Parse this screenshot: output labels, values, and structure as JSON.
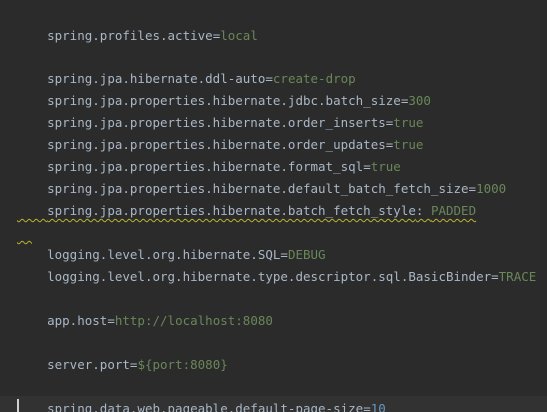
{
  "editor": {
    "lines": [
      {
        "key": "spring.profiles.active",
        "sep": "=",
        "value": "local"
      },
      {
        "key": "spring.jpa.hibernate.ddl-auto",
        "sep": "=",
        "value": "create-drop"
      },
      {
        "key": "spring.jpa.properties.hibernate.jdbc.batch_size",
        "sep": "=",
        "value": "300"
      },
      {
        "key": "spring.jpa.properties.hibernate.order_inserts",
        "sep": "=",
        "value": "true"
      },
      {
        "key": "spring.jpa.properties.hibernate.order_updates",
        "sep": "=",
        "value": "true"
      },
      {
        "key": "spring.jpa.properties.hibernate.format_sql",
        "sep": "=",
        "value": "true"
      },
      {
        "key": "spring.jpa.properties.hibernate.default_batch_fetch_size",
        "sep": "=",
        "value": "1000"
      },
      {
        "key": "spring.jpa.properties.hibernate.batch_fetch_style",
        "sep": ": ",
        "value": "PADDED"
      },
      {
        "key": "logging.level.org.hibernate.SQL",
        "sep": "=",
        "value": "DEBUG"
      },
      {
        "key": "logging.level.org.hibernate.type.descriptor.sql.BasicBinder",
        "sep": "=",
        "value": "TRACE"
      },
      {
        "key": "app.host",
        "sep": "=",
        "value": "http://localhost:8080"
      },
      {
        "key": "server.port",
        "sep": "=",
        "value": "${port:8080}"
      },
      {
        "key": "spring.data.web.pageable.default-page-size",
        "sep": "=",
        "value": "10"
      }
    ]
  },
  "colors": {
    "background": "#2b2b2b",
    "key": "#a9b7c6",
    "value": "#6a8759",
    "warning_underline": "#bbb529"
  }
}
